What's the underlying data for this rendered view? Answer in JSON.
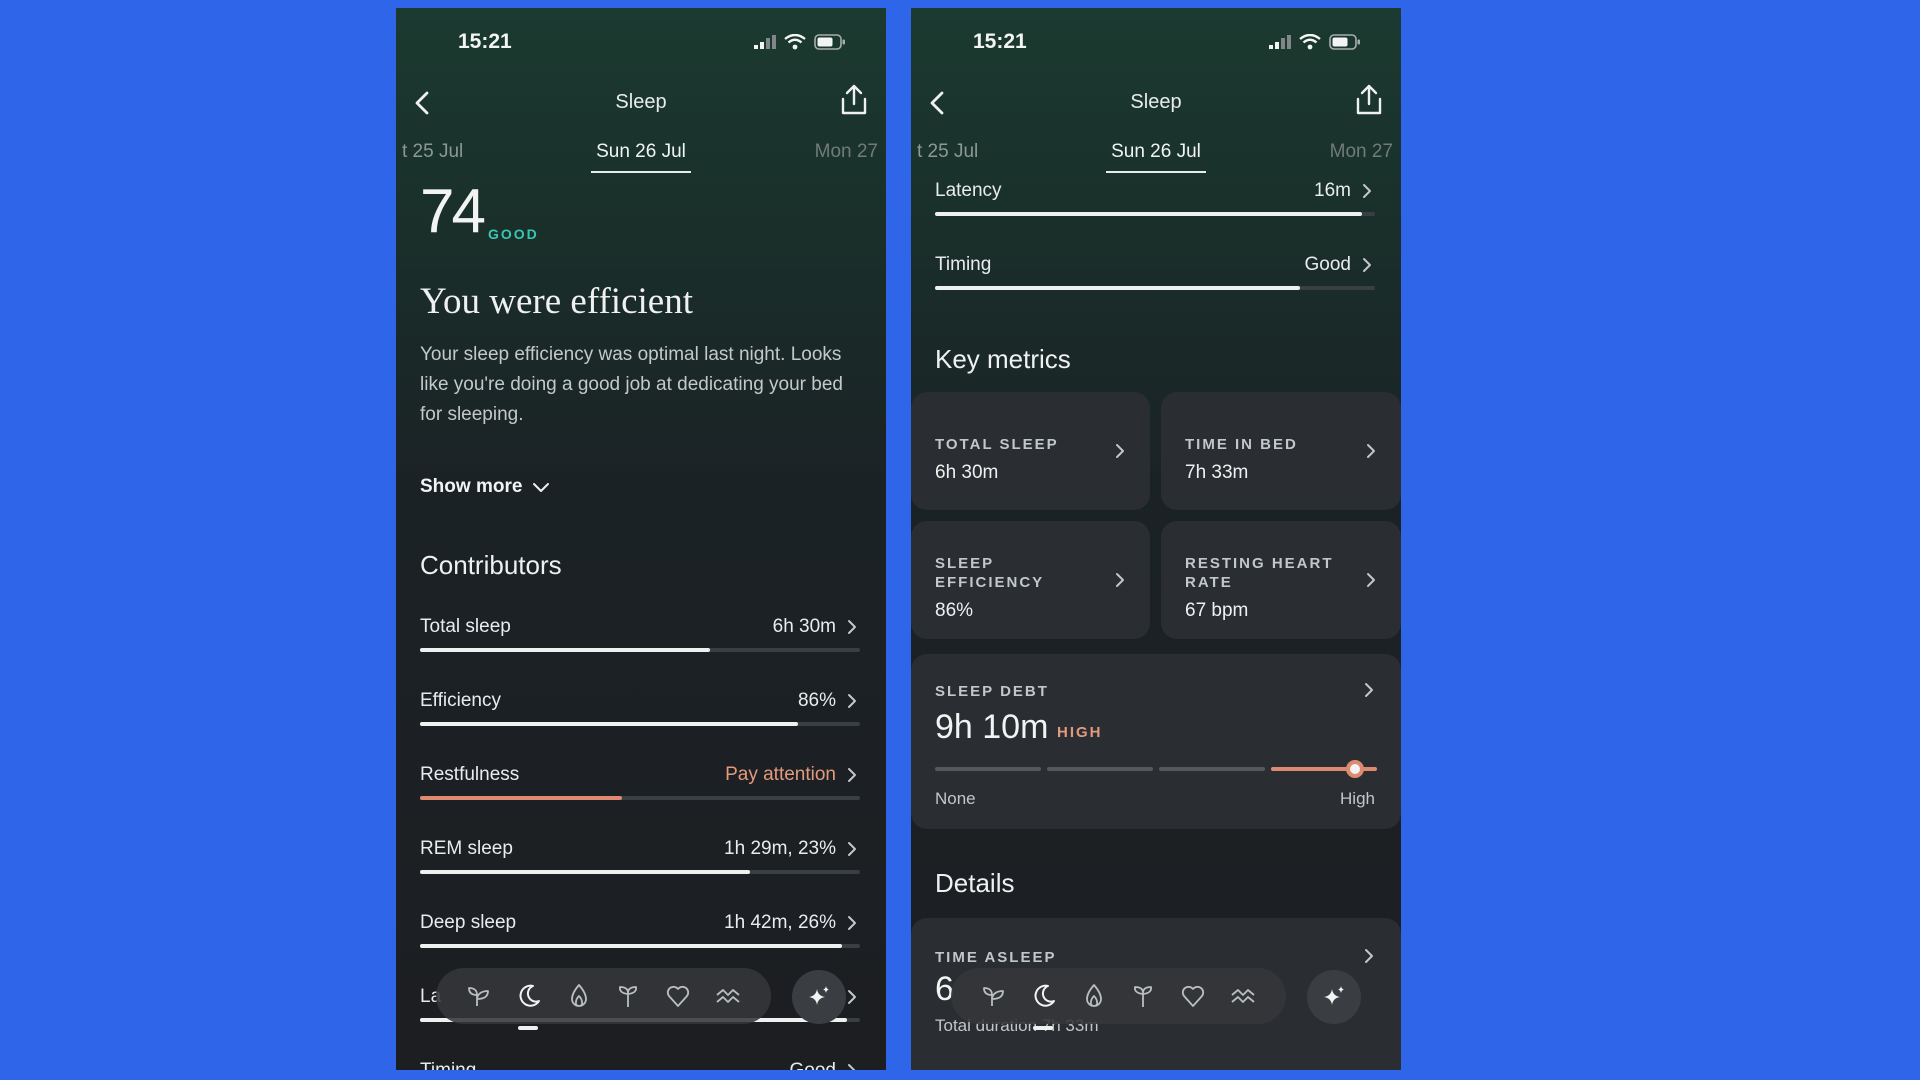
{
  "left": {
    "status": {
      "time": "15:21"
    },
    "nav": {
      "title": "Sleep"
    },
    "dates": {
      "prev": "t 25 Jul",
      "current": "Sun 26 Jul",
      "next": "Mon 27"
    },
    "score": {
      "value": "74",
      "rating": "GOOD"
    },
    "headline": "You were efficient",
    "summary": "Your sleep efficiency was optimal last night. Looks like you're doing a good job at dedicating your bed for sleeping.",
    "show_more": "Show more",
    "contributors_title": "Contributors",
    "contributors": [
      {
        "label": "Total sleep",
        "value": "6h 30m",
        "progress": 0.66,
        "status": "normal"
      },
      {
        "label": "Efficiency",
        "value": "86%",
        "progress": 0.86,
        "status": "normal"
      },
      {
        "label": "Restfulness",
        "value": "Pay attention",
        "progress": 0.46,
        "status": "warning"
      },
      {
        "label": "REM sleep",
        "value": "1h 29m, 23%",
        "progress": 0.75,
        "status": "normal"
      },
      {
        "label": "Deep sleep",
        "value": "1h 42m, 26%",
        "progress": 0.96,
        "status": "normal"
      },
      {
        "label": "La",
        "value": "",
        "progress": 0.97,
        "status": "normal"
      },
      {
        "label": "Timing",
        "value": "Good",
        "progress": 0.83,
        "status": "normal"
      }
    ]
  },
  "right": {
    "status": {
      "time": "15:21"
    },
    "nav": {
      "title": "Sleep"
    },
    "dates": {
      "prev": "t 25 Jul",
      "current": "Sun 26 Jul",
      "next": "Mon 27"
    },
    "contributors": [
      {
        "label": "Latency",
        "value": "16m",
        "progress": 0.97
      },
      {
        "label": "Timing",
        "value": "Good",
        "progress": 0.83
      }
    ],
    "key_metrics_title": "Key metrics",
    "key_metrics": [
      {
        "label": "TOTAL SLEEP",
        "value": "6h 30m"
      },
      {
        "label": "TIME IN BED",
        "value": "7h 33m"
      },
      {
        "label": "SLEEP EFFICIENCY",
        "value": "86%"
      },
      {
        "label": "RESTING HEART RATE",
        "value": "67 bpm"
      }
    ],
    "sleep_debt": {
      "label": "SLEEP DEBT",
      "value": "9h 10m",
      "level": "HIGH",
      "scale_min": "None",
      "scale_max": "High",
      "level_fraction": 0.95
    },
    "details_title": "Details",
    "details": {
      "label": "TIME ASLEEP",
      "value": "6",
      "sub": "Total duration 7h 33m"
    }
  },
  "tabbar": {
    "icons": [
      "sprout-icon",
      "moon-icon",
      "flame-icon",
      "seedling-icon",
      "heart-icon",
      "waves-icon"
    ],
    "active": "moon-icon",
    "fab_icon": "sparkle-icon"
  },
  "colors": {
    "accent_good": "#39c7b1",
    "warning": "#e39a7c",
    "background": "#2f65e8"
  }
}
